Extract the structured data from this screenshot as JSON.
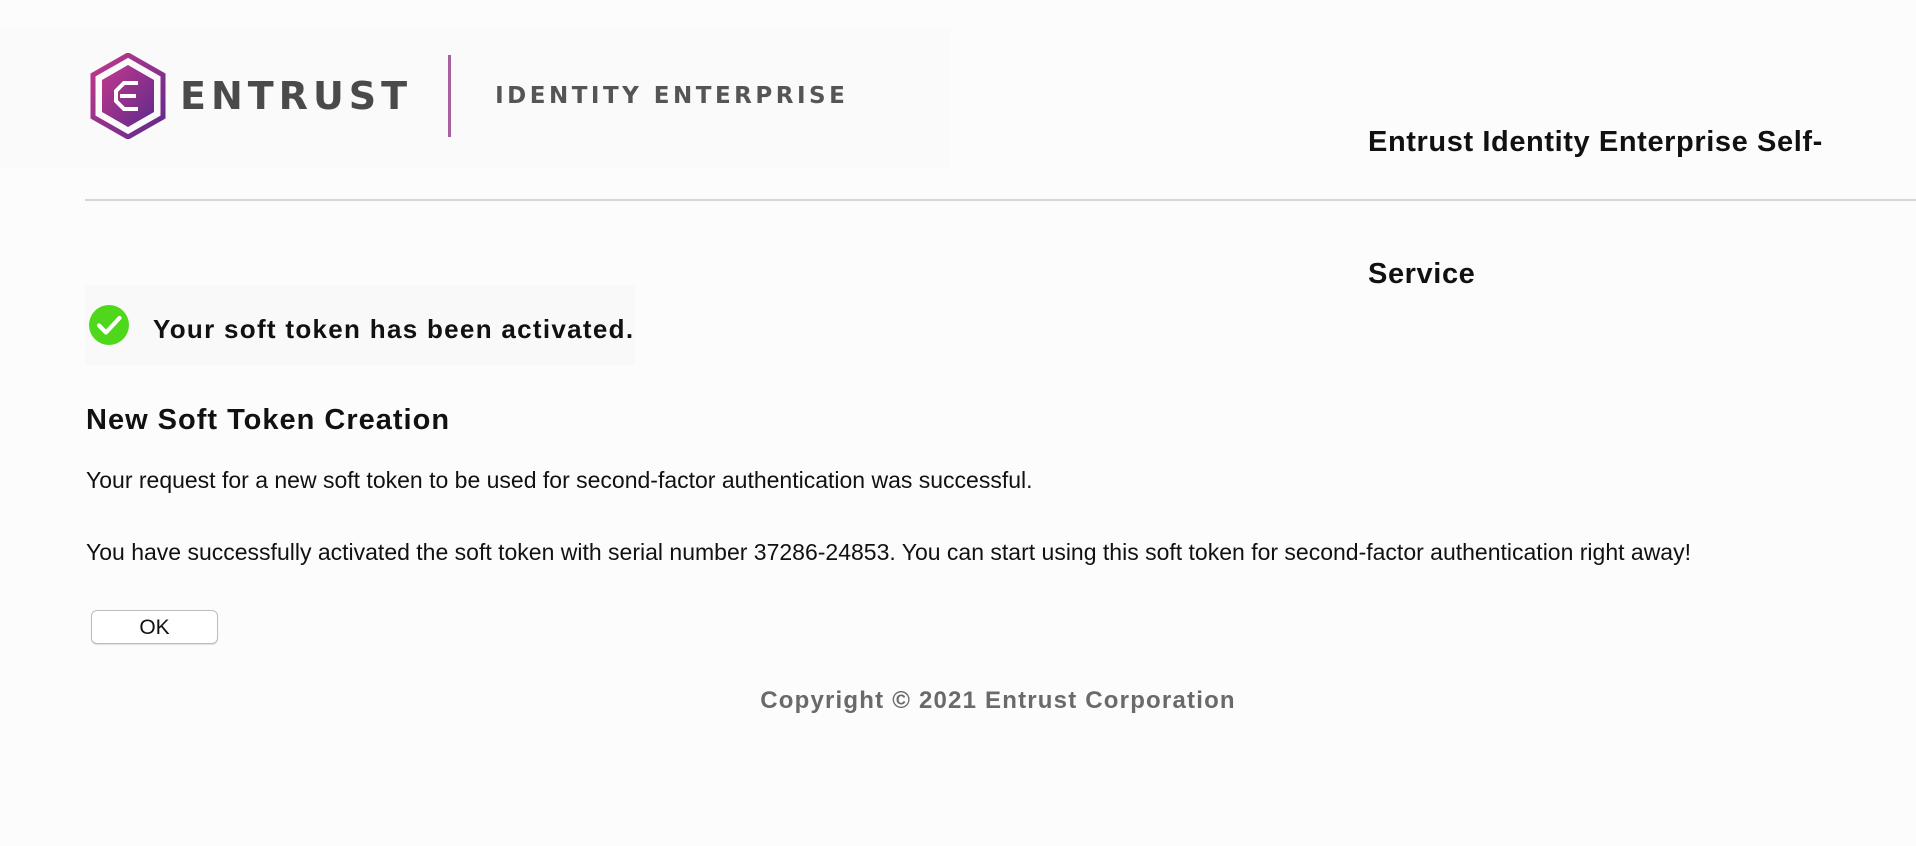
{
  "header": {
    "logo": {
      "wordmark": "ENTRUST",
      "product": "IDENTITY ENTERPRISE",
      "brand_colors": [
        "#b8398e",
        "#6a2c8f"
      ],
      "divider_color": "#a7619f"
    },
    "app_title": "Entrust Identity Enterprise Self-Service"
  },
  "alert": {
    "icon": "check-circle-icon",
    "icon_color": "#4ed71b",
    "message": "Your soft token has been activated."
  },
  "main": {
    "title": "New Soft Token Creation",
    "paragraph_1": "Your request for a new soft token to be used for second-factor authentication was successful.",
    "paragraph_2": "You have successfully activated the soft token with serial number 37286-24853. You can start using this soft token for second-factor authentication right away!",
    "ok_label": "OK"
  },
  "footer": {
    "copyright": "Copyright © 2021 Entrust Corporation"
  }
}
